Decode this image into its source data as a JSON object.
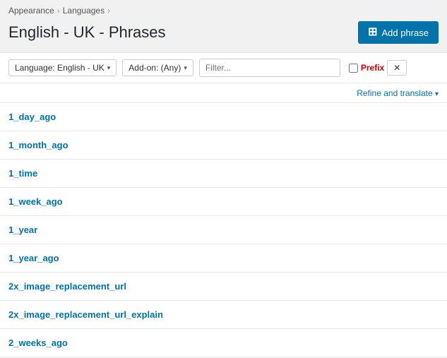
{
  "breadcrumb": {
    "items": [
      {
        "label": "Appearance",
        "href": "#"
      },
      {
        "label": "Languages",
        "href": "#"
      }
    ]
  },
  "page": {
    "title": "English - UK - Phrases"
  },
  "add_phrase_button": {
    "label": "Add phrase",
    "icon": "+"
  },
  "toolbar": {
    "language_label": "Language: English - UK",
    "addon_label": "Add-on: (Any)",
    "filter_placeholder": "Filter...",
    "prefix_label": "Prefix"
  },
  "refine": {
    "label": "Refine and translate"
  },
  "phrases": [
    {
      "key": "1_day_ago"
    },
    {
      "key": "1_month_ago"
    },
    {
      "key": "1_time"
    },
    {
      "key": "1_week_ago"
    },
    {
      "key": "1_year"
    },
    {
      "key": "1_year_ago"
    },
    {
      "key": "2x_image_replacement_url"
    },
    {
      "key": "2x_image_replacement_url_explain"
    },
    {
      "key": "2_weeks_ago"
    }
  ]
}
